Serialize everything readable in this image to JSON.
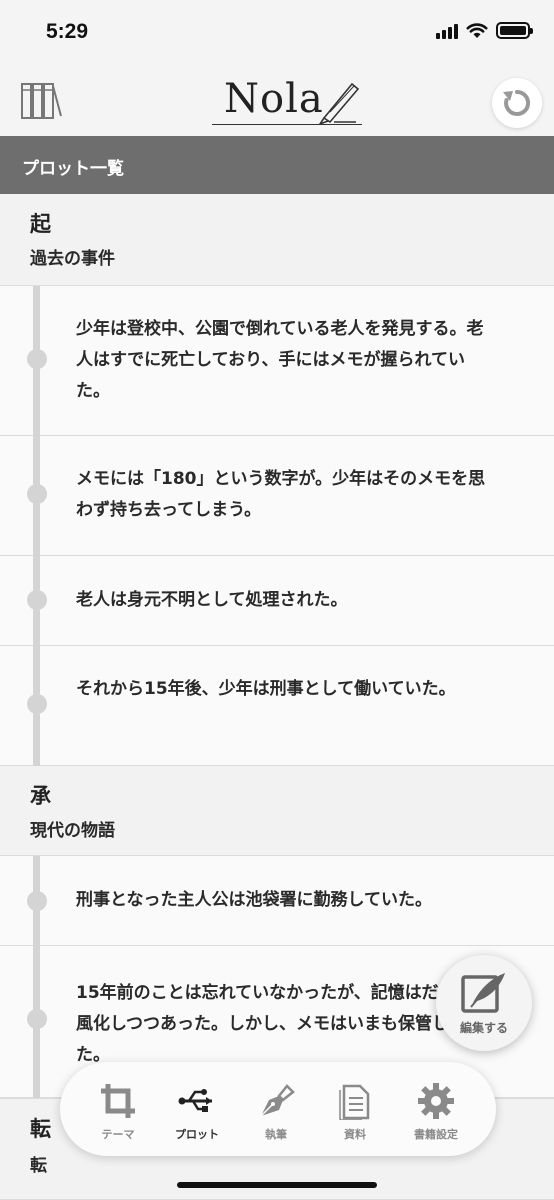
{
  "status": {
    "time": "5:29"
  },
  "header": {
    "logo_text": "Nola"
  },
  "section": {
    "title": "プロット一覧"
  },
  "groups": [
    {
      "label": "起",
      "subtitle": "過去の事件",
      "items": [
        "少年は登校中、公園で倒れている老人を発見する。老人はすでに死亡しており、手にはメモが握られていた。",
        "メモには「180」という数字が。少年はそのメモを思わず持ち去ってしまう。",
        "老人は身元不明として処理された。",
        "それから15年後、少年は刑事として働いていた。"
      ]
    },
    {
      "label": "承",
      "subtitle": "現代の物語",
      "items": [
        "刑事となった主人公は池袋署に勤務していた。",
        "15年前のことは忘れていなかったが、記憶はだんだん風化しつつあった。しかし、メモはいまも保管していた。"
      ]
    },
    {
      "label": "転",
      "subtitle": "転"
    }
  ],
  "edit_button": {
    "label": "編集する"
  },
  "nav": {
    "items": [
      {
        "label": "テーマ",
        "icon": "crop-icon"
      },
      {
        "label": "プロット",
        "icon": "usb-icon"
      },
      {
        "label": "執筆",
        "icon": "pen-nib-icon"
      },
      {
        "label": "資料",
        "icon": "document-icon"
      },
      {
        "label": "書籍設定",
        "icon": "gear-icon"
      }
    ],
    "active": "プロット"
  }
}
